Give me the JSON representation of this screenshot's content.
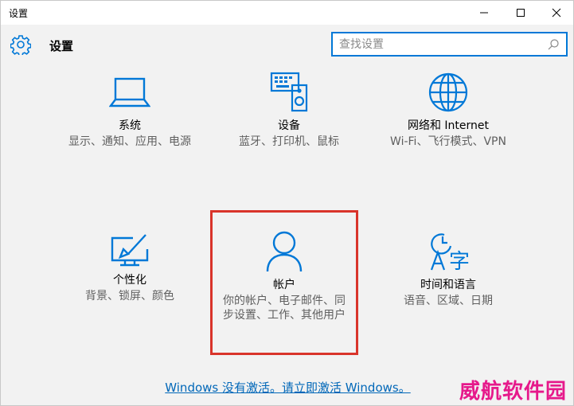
{
  "window": {
    "title": "设置"
  },
  "header": {
    "title": "设置",
    "search_placeholder": "查找设置"
  },
  "tiles": [
    {
      "name": "系统",
      "desc": "显示、通知、应用、电源",
      "icon": "monitor-icon"
    },
    {
      "name": "设备",
      "desc": "蓝牙、打印机、鼠标",
      "icon": "devices-icon"
    },
    {
      "name": "网络和 Internet",
      "desc": "Wi-Fi、飞行模式、VPN",
      "icon": "globe-icon"
    },
    {
      "name": "个性化",
      "desc": "背景、锁屏、颜色",
      "icon": "personalize-icon"
    },
    {
      "name": "帐户",
      "desc": "你的帐户、电子邮件、同步设置、工作、其他用户",
      "icon": "person-icon"
    },
    {
      "name": "时间和语言",
      "desc": "语音、区域、日期",
      "icon": "time-language-icon"
    }
  ],
  "activation_link": "Windows 没有激活。请立即激活 Windows。",
  "watermark": "威航软件园",
  "colors": {
    "accent": "#0078d7",
    "highlight": "#d9342b",
    "link": "#0067b8"
  }
}
